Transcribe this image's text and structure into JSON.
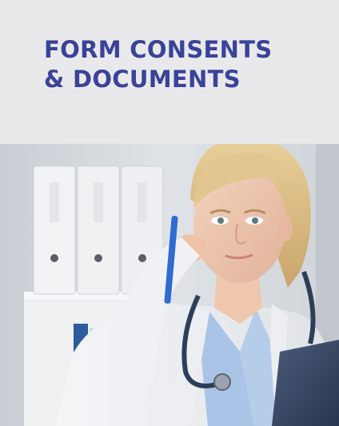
{
  "card": {
    "title_line1": "FORM CONSENTS",
    "title_line2": "& DOCUMENTS",
    "title_color": "#3a4398",
    "header_bg": "#e9e9ec"
  },
  "photo": {
    "subject": "doctor-with-stethoscope-and-pen"
  }
}
